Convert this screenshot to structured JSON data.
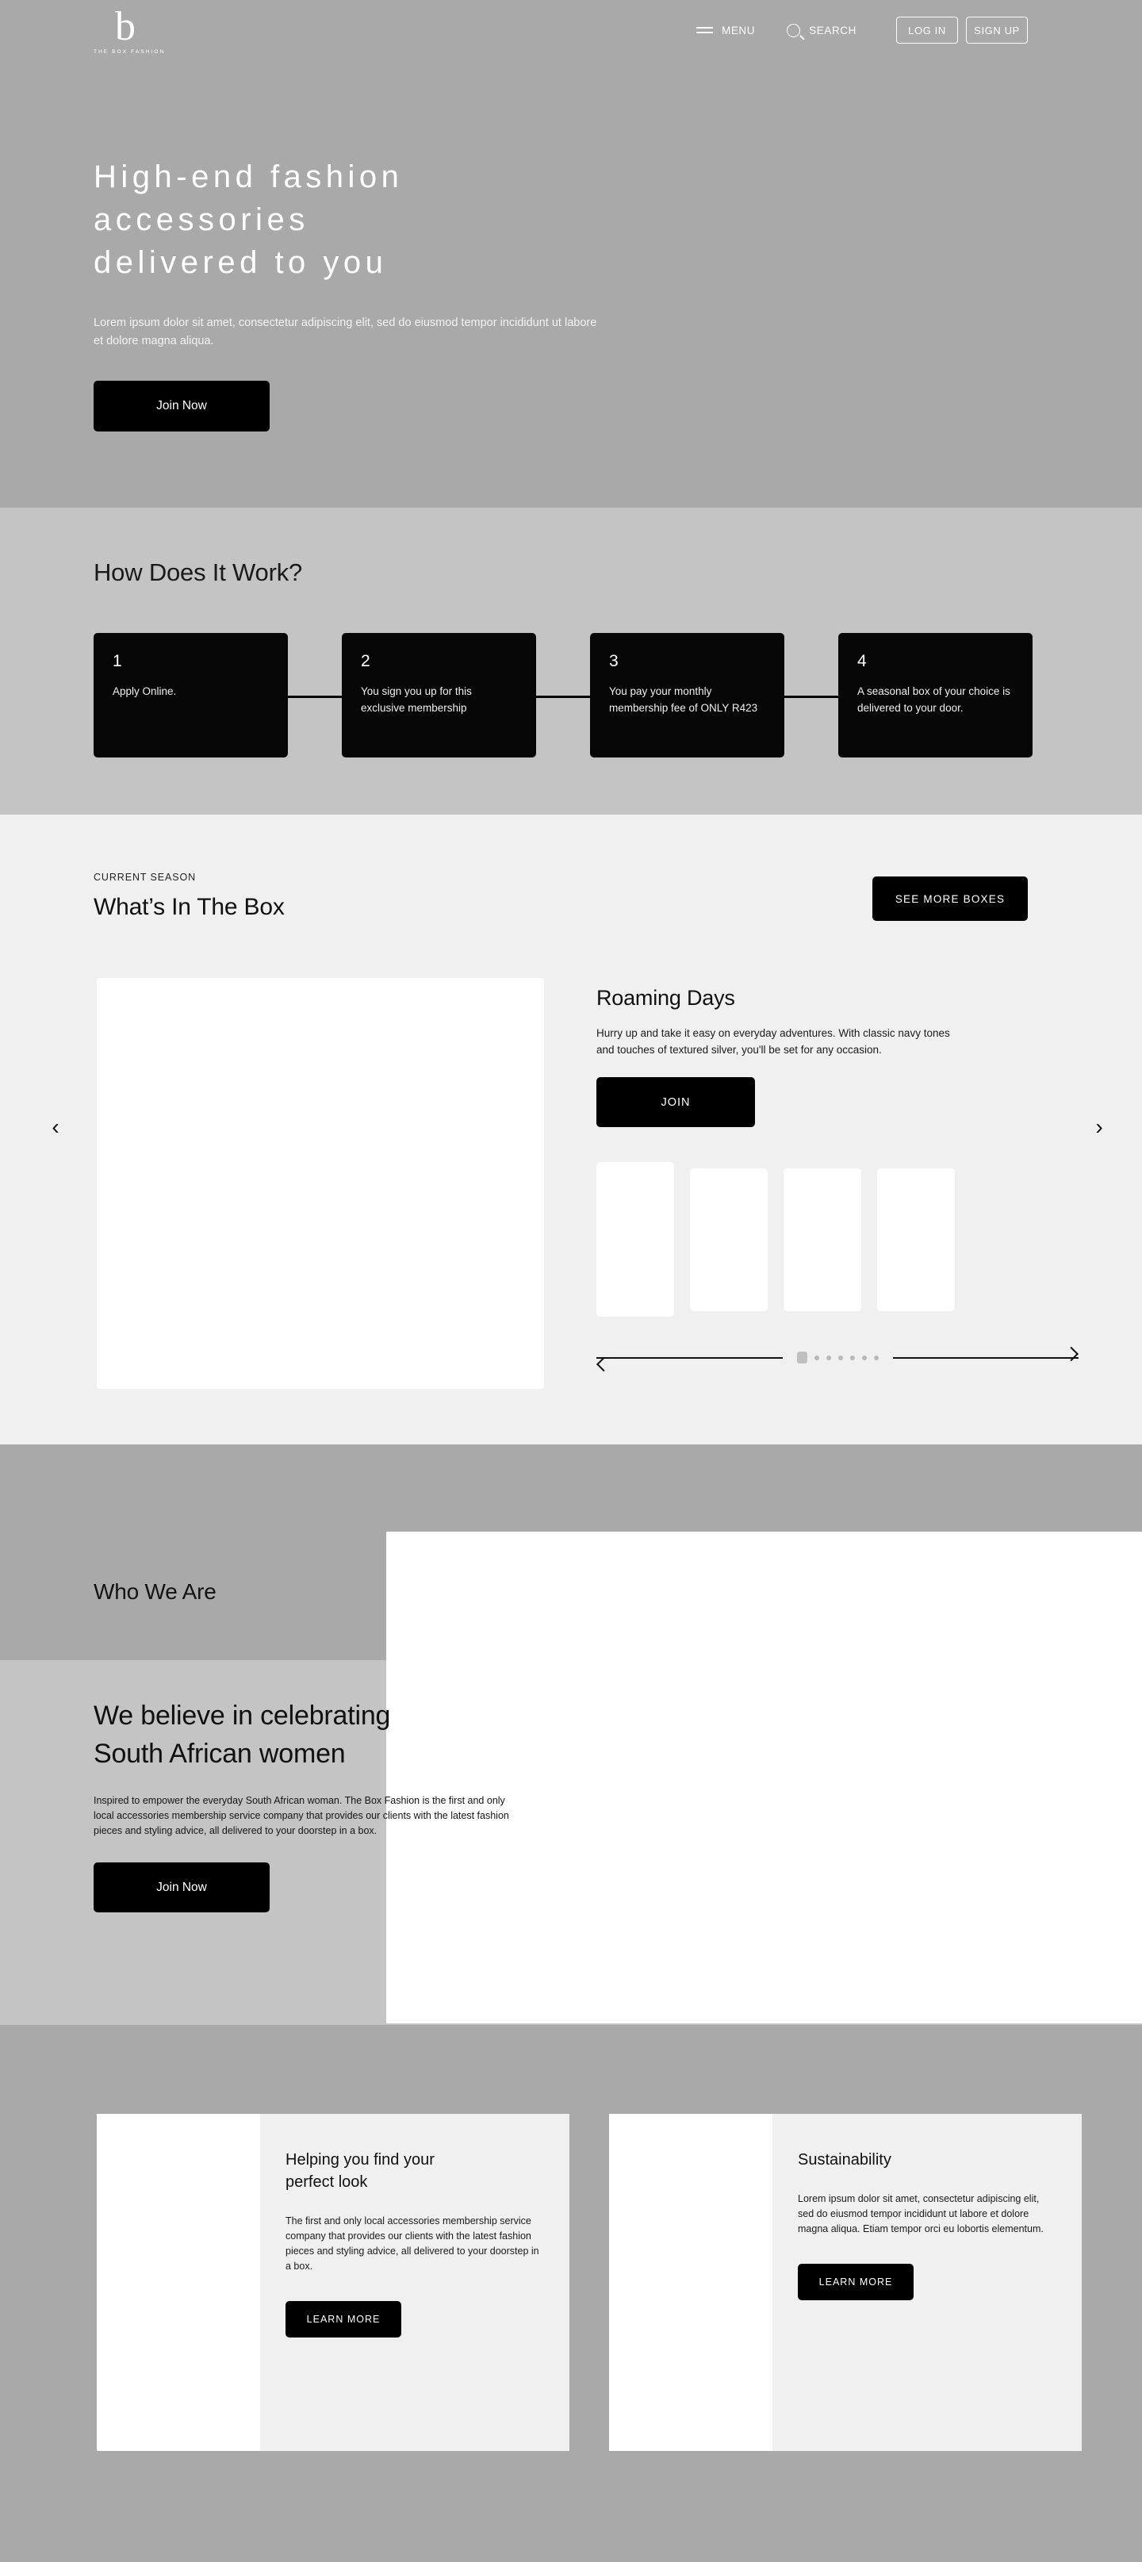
{
  "brand": {
    "mark": "b",
    "name": "THE BOX FASHION"
  },
  "nav": {
    "menu_label": "MENU",
    "search_label": "SEARCH",
    "login_label": "LOG IN",
    "signup_label": "SIGN UP",
    "icons": {
      "menu": "hamburger-icon",
      "search": "search-icon"
    }
  },
  "hero": {
    "title": "High-end fashion\naccessories\ndelivered to you",
    "subtitle": "Lorem ipsum dolor sit amet, consectetur adipiscing elit, sed do eiusmod tempor incididunt ut labore et dolore magna aliqua.",
    "cta_label": "Join Now",
    "background_color": "#a9a9a9"
  },
  "how_it_works": {
    "title": "How Does It Work?",
    "background_color": "#c4c4c4",
    "steps": [
      {
        "number": "1",
        "text": "Apply Online."
      },
      {
        "number": "2",
        "text": "You sign you up for this exclusive membership"
      },
      {
        "number": "3",
        "text": "You pay your monthly membership fee of ONLY R423"
      },
      {
        "number": "4",
        "text": "A seasonal box of your choice is delivered to your door."
      }
    ]
  },
  "box_section": {
    "eyebrow": "CURRENT SEASON",
    "title": "What’s In The Box",
    "see_more_label": "SEE MORE BOXES",
    "background_color": "#f0f0f0",
    "prev_icon": "chevron-left-icon",
    "next_icon": "chevron-right-icon",
    "product": {
      "name": "Roaming Days",
      "description": "Hurry up and take it easy on everyday adventures. With classic navy tones and touches of textured silver, you'll be set for any occasion.",
      "join_label": "JOIN"
    },
    "pagination": {
      "total": 7,
      "active_index": 0
    }
  },
  "who_we_are": {
    "label": "Who We Are",
    "heading": "We believe in celebrating\nSouth African women",
    "paragraph": "Inspired to empower the everyday South African woman. The Box Fashion is the first and only local accessories membership service company that provides our clients with the latest fashion pieces and styling advice, all delivered to your doorstep in a box.",
    "cta_label": "Join Now"
  },
  "features": {
    "background_color": "#a9a9a9",
    "cards": [
      {
        "title": "Helping you find your\nperfect look",
        "body": "The first and only local accessories membership service company that provides our clients with the latest fashion pieces and styling advice, all delivered to your doorstep in a box.",
        "cta_label": "LEARN MORE"
      },
      {
        "title": "Sustainability",
        "body": "Lorem ipsum dolor sit amet, consectetur adipiscing elit, sed do eiusmod tempor incididunt ut labore et dolore magna aliqua. Etiam tempor orci eu lobortis elementum.",
        "cta_label": "LEARN MORE"
      }
    ]
  }
}
